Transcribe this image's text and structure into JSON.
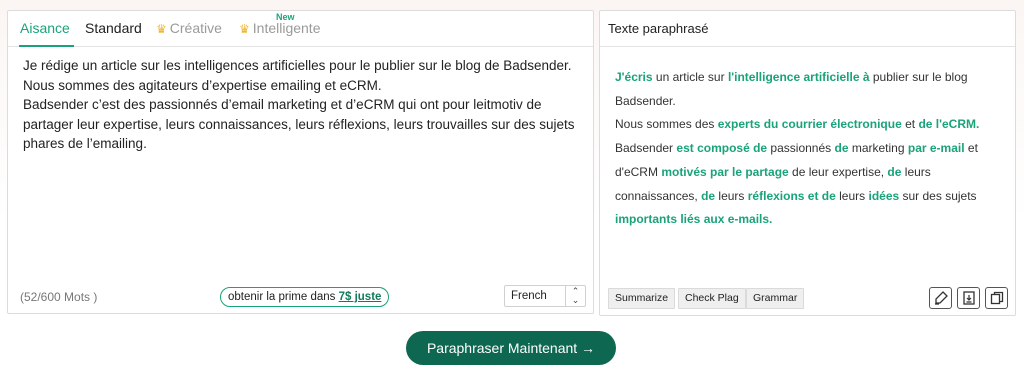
{
  "tabs": [
    {
      "label": "Aisance"
    },
    {
      "label": "Standard"
    },
    {
      "label": "Créative",
      "icon": "crown-icon"
    },
    {
      "label": "Intelligente",
      "icon": "crown-icon",
      "badge": "New"
    }
  ],
  "input": {
    "lines": [
      "Je rédige un article sur les intelligences artificielles pour le publier sur le blog de Badsender.",
      "Nous sommes des agitateurs d’expertise emailing et eCRM.",
      "Badsender c’est des passionnés d’email marketing et d’eCRM qui ont pour leitmotiv de partager leur expertise, leurs connaissances, leurs réflexions, leurs trouvailles sur des sujets phares de l’emailing."
    ]
  },
  "word_count": "(52/600 Mots )",
  "promo": {
    "text": "obtenir la prime dans ",
    "link": "7$ juste"
  },
  "language": {
    "selected": "French"
  },
  "output": {
    "title": "Texte paraphrasé",
    "paragraphs": [
      [
        {
          "t": "J'écris",
          "hl": true
        },
        {
          "t": " un article sur ",
          "hl": false
        },
        {
          "t": "l'intelligence artificielle à",
          "hl": true
        },
        {
          "t": " publier sur le blog Badsender.",
          "hl": false
        }
      ],
      [
        {
          "t": "Nous sommes des ",
          "hl": false
        },
        {
          "t": "experts du courrier électronique",
          "hl": true
        },
        {
          "t": " et ",
          "hl": false
        },
        {
          "t": "de l'eCRM.",
          "hl": true
        }
      ],
      [
        {
          "t": "Badsender ",
          "hl": false
        },
        {
          "t": "est composé de",
          "hl": true
        },
        {
          "t": " passionnés ",
          "hl": false
        },
        {
          "t": "de",
          "hl": true
        },
        {
          "t": " marketing ",
          "hl": false
        },
        {
          "t": "par e-mail",
          "hl": true
        },
        {
          "t": " et d'eCRM ",
          "hl": false
        },
        {
          "t": "motivés par le partage",
          "hl": true
        },
        {
          "t": " de leur expertise, ",
          "hl": false
        },
        {
          "t": "de",
          "hl": true
        },
        {
          "t": " leurs connaissances, ",
          "hl": false
        },
        {
          "t": "de",
          "hl": true
        },
        {
          "t": " leurs ",
          "hl": false
        },
        {
          "t": "réflexions et de",
          "hl": true
        },
        {
          "t": " leurs ",
          "hl": false
        },
        {
          "t": "idées",
          "hl": true
        },
        {
          "t": " sur des sujets ",
          "hl": false
        },
        {
          "t": "importants liés aux e-mails.",
          "hl": true
        }
      ]
    ],
    "tools": [
      "Summarize",
      "Check Plag",
      "Grammar"
    ],
    "icons": [
      "highlighter-icon",
      "download-icon",
      "copy-icon"
    ]
  },
  "action": {
    "label": "Paraphraser Maintenant →"
  },
  "colors": {
    "accent": "#1aa37a",
    "button": "#0e6750"
  }
}
